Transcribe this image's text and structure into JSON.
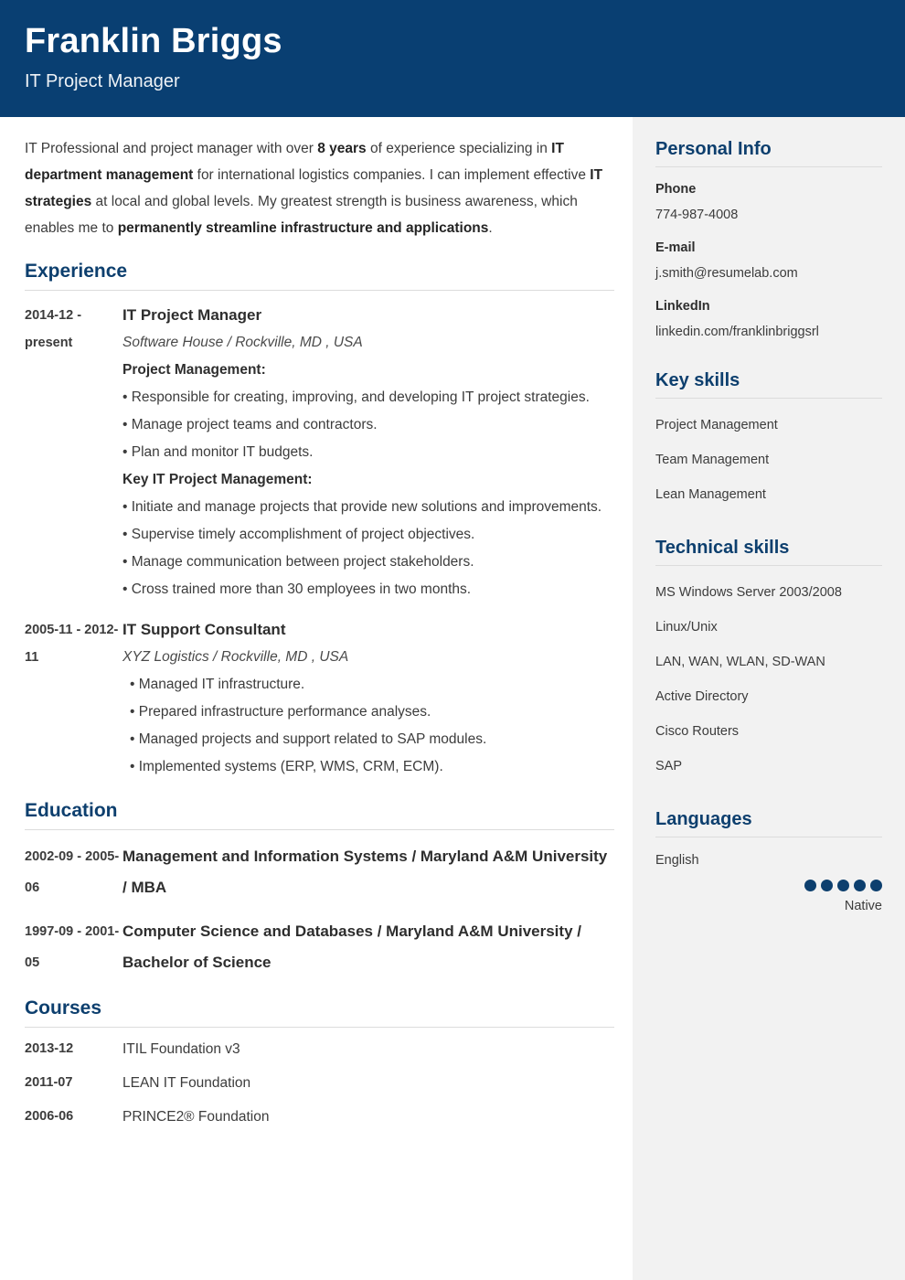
{
  "theme": {
    "header_bg": "#093f72",
    "accent": "#0d3f6e",
    "sidebar_bg": "#f2f2f2",
    "rule": "#dcdcdc",
    "body_text": "#3c3c3c"
  },
  "header": {
    "name": "Franklin Briggs",
    "job_title": "IT Project Manager"
  },
  "summary": {
    "parts": [
      {
        "text": "IT Professional and project manager with over ",
        "bold": false
      },
      {
        "text": "8 years",
        "bold": true
      },
      {
        "text": " of experience specializing in ",
        "bold": false
      },
      {
        "text": "IT department management",
        "bold": true
      },
      {
        "text": " for international logistics companies. I can implement effective ",
        "bold": false
      },
      {
        "text": "IT strategies",
        "bold": true
      },
      {
        "text": " at local and global levels. My greatest strength is business awareness, which enables me to ",
        "bold": false
      },
      {
        "text": "permanently streamline infrastructure and applications",
        "bold": true
      },
      {
        "text": ".",
        "bold": false
      }
    ]
  },
  "sections": {
    "experience": {
      "heading": "Experience",
      "entries": [
        {
          "date": "2014-12 - present",
          "title": "IT Project Manager",
          "subtitle": "Software House / Rockville, MD , USA",
          "blocks": [
            {
              "type": "grouphead",
              "text": "Project Management:"
            },
            {
              "type": "bullet",
              "text": "• Responsible for creating, improving, and developing IT project strategies."
            },
            {
              "type": "bullet",
              "text": "• Manage project teams and contractors."
            },
            {
              "type": "bullet",
              "text": "• Plan and monitor IT budgets."
            },
            {
              "type": "grouphead",
              "text": "Key IT Project Management:"
            },
            {
              "type": "bullet",
              "text": "• Initiate and manage projects that provide new solutions and improvements."
            },
            {
              "type": "bullet",
              "text": "• Supervise timely accomplishment of project objectives."
            },
            {
              "type": "bullet",
              "text": "• Manage communication between project stakeholders."
            },
            {
              "type": "bullet",
              "text": "• Cross trained more than 30 employees in two months."
            }
          ]
        },
        {
          "date": "2005-11 - 2012-11",
          "title": "IT Support Consultant",
          "subtitle": "XYZ Logistics / Rockville, MD , USA",
          "blocks": [
            {
              "type": "bullet-indent",
              "text": "• Managed IT infrastructure."
            },
            {
              "type": "bullet-indent",
              "text": "• Prepared infrastructure performance analyses."
            },
            {
              "type": "bullet-indent",
              "text": "• Managed projects and support related to SAP modules."
            },
            {
              "type": "bullet-indent",
              "text": "• Implemented systems (ERP, WMS, CRM, ECM)."
            }
          ]
        }
      ]
    },
    "education": {
      "heading": "Education",
      "entries": [
        {
          "date": "2002-09 - 2005-06",
          "title": "Management and Information Systems / Maryland A&M University / MBA"
        },
        {
          "date": "1997-09 - 2001-05",
          "title": "Computer Science and Databases / Maryland A&M University / Bachelor of Science"
        }
      ]
    },
    "courses": {
      "heading": "Courses",
      "entries": [
        {
          "date": "2013-12",
          "name": "ITIL Foundation v3"
        },
        {
          "date": "2011-07",
          "name": "LEAN IT Foundation"
        },
        {
          "date": "2006-06",
          "name": "PRINCE2® Foundation"
        }
      ]
    }
  },
  "sidebar": {
    "personal_info": {
      "heading": "Personal Info",
      "fields": [
        {
          "label": "Phone",
          "value": "774-987-4008"
        },
        {
          "label": "E-mail",
          "value": "j.smith@resumelab.com"
        },
        {
          "label": "LinkedIn",
          "value": "linkedin.com/franklinbriggsrl"
        }
      ]
    },
    "key_skills": {
      "heading": "Key skills",
      "items": [
        "Project Management",
        "Team Management",
        "Lean Management"
      ]
    },
    "technical_skills": {
      "heading": "Technical skills",
      "items": [
        "MS Windows Server 2003/2008",
        "Linux/Unix",
        "LAN, WAN, WLAN, SD-WAN",
        "Active Directory",
        "Cisco Routers",
        "SAP"
      ]
    },
    "languages": {
      "heading": "Languages",
      "items": [
        {
          "name": "English",
          "level": "Native",
          "rating": 5,
          "max": 5
        }
      ]
    }
  }
}
